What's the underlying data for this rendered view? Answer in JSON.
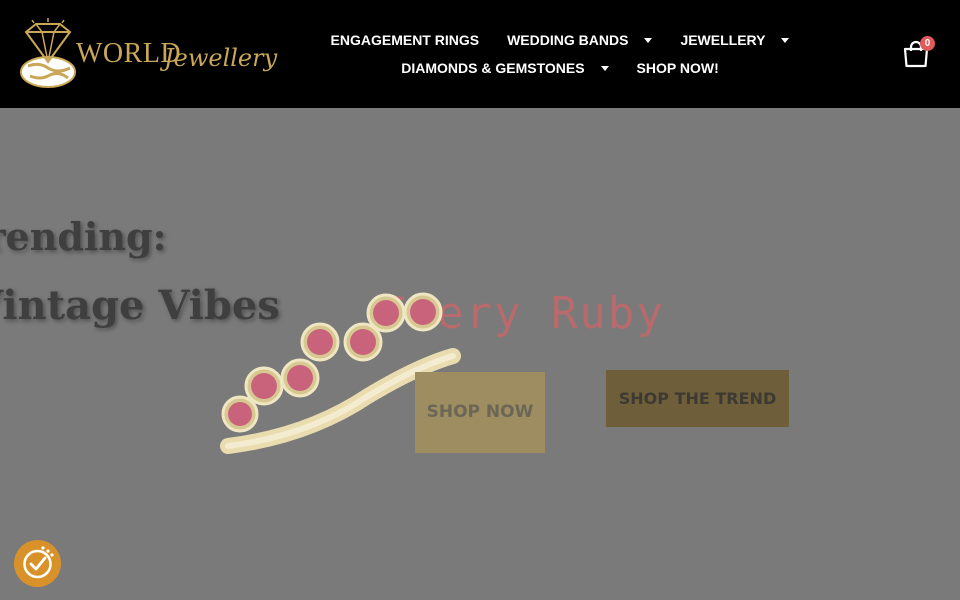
{
  "logo": {
    "word1": "WORLD",
    "word2": "Jewellery"
  },
  "nav": {
    "row1": [
      {
        "label": "ENGAGEMENT RINGS",
        "dropdown": false
      },
      {
        "label": "WEDDING BANDS",
        "dropdown": true
      },
      {
        "label": "JEWELLERY",
        "dropdown": true
      }
    ],
    "row2": [
      {
        "label": "DIAMONDS & GEMSTONES",
        "dropdown": true
      },
      {
        "label": "SHOP NOW!",
        "dropdown": false
      }
    ]
  },
  "cart": {
    "count": "0",
    "icon": "shopping-bag-icon"
  },
  "hero": {
    "line1": "Trending:",
    "line2": "Vintage Vibes",
    "ruby_title": "Fiery Ruby",
    "shop_now": "SHOP NOW",
    "shop_trend": "SHOP THE TREND"
  },
  "widget": {
    "icon": "accessibility-check-icon"
  },
  "colors": {
    "header_bg": "#000000",
    "gold": "#c9a757",
    "badge": "#e05a5a",
    "overlay": "#7a7a7a",
    "widget": "#d9922a"
  }
}
